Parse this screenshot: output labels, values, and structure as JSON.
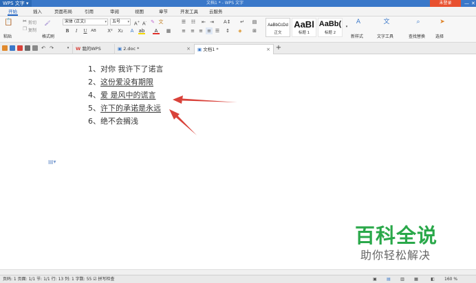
{
  "titlebar": {
    "app_menu": "WPS 文字 ▾",
    "window_title": "文档1 * - WPS 文字",
    "login_button": "未登录",
    "min": "—",
    "close": "✕"
  },
  "ribbon_tabs": [
    "开始",
    "插入",
    "页面布局",
    "引用",
    "审阅",
    "视图",
    "章节",
    "开发工具",
    "云服务"
  ],
  "toolbar": {
    "paste": "粘贴",
    "cut": "剪切",
    "copy": "复制",
    "format_painter": "格式刷",
    "font_name": "宋体 (正文)",
    "font_size": "五号",
    "bold": "B",
    "italic": "I",
    "underline": "U",
    "styles": [
      {
        "preview": "AaBbCcDd",
        "name": "正文"
      },
      {
        "preview": "AaBl",
        "name": "标题 1"
      },
      {
        "preview": "AaBb(",
        "name": "标题 2"
      }
    ],
    "new_style": "新样式",
    "text_tools": "文字工具",
    "find_replace": "查找替换",
    "select": "选择"
  },
  "doc_tabs": [
    {
      "label": "我的WPS"
    },
    {
      "label": "2.doc *"
    },
    {
      "label": "文档1 *"
    }
  ],
  "document": {
    "lines": [
      {
        "num": "1、",
        "text": "对你  我许下了诺言"
      },
      {
        "num": "2、",
        "text": "这份爱没有期限"
      },
      {
        "num": "4、",
        "text": "爱  是风中的谎言"
      },
      {
        "num": "5、",
        "text": "许下的承诺是永远"
      },
      {
        "num": "6、",
        "text": "绝不会搁浅"
      }
    ]
  },
  "watermark": {
    "title": "百科全说",
    "subtitle": "助你轻松解决"
  },
  "status": {
    "text": "页码: 1  页面: 1/1  节: 1/1  行: 13  列: 1  字数: 55  ☑ 拼写检查",
    "zoom": "160 %"
  },
  "colors": {
    "titlebar": "#3a78c9",
    "accent": "#1e62c4",
    "arrow": "#d9423a",
    "watermark_green": "#2aa84a",
    "login": "#e8502f"
  }
}
